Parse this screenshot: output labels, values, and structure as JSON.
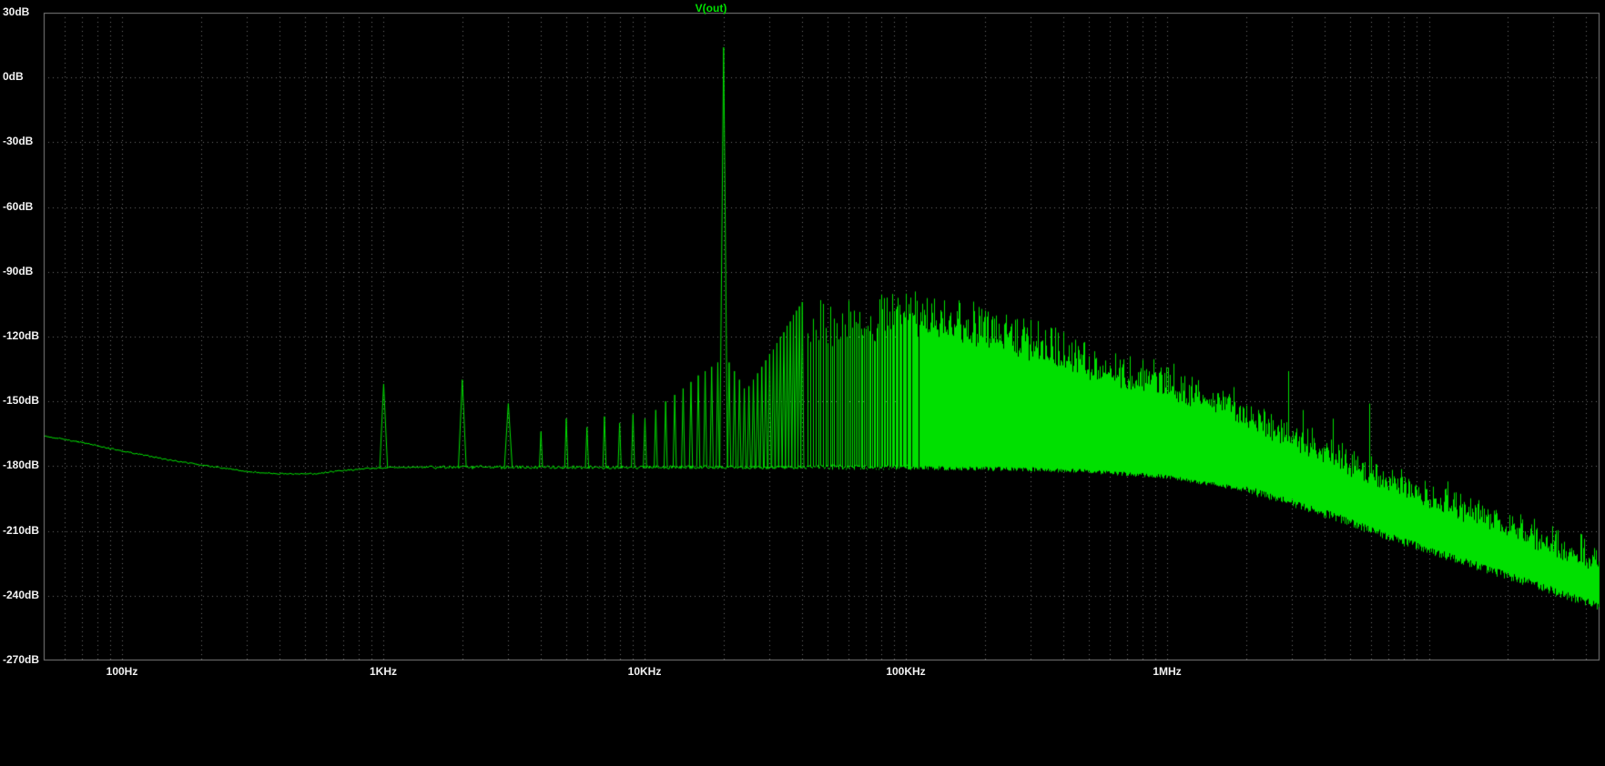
{
  "colors": {
    "background": "#000000",
    "frame": "#909090",
    "plot_border": "#808080",
    "grid": "#6E6E6E",
    "axis_label": "#F2F2F2",
    "trace": "#00E000"
  },
  "chart_data": {
    "type": "line",
    "title": "V(out)",
    "subtitle": "",
    "legend_position": "top-center",
    "grid": "dotted",
    "series": [
      {
        "name": "V(out)",
        "color": "#00E000"
      }
    ],
    "x_axis": {
      "unit": "Hz",
      "scale": "log",
      "min_hz": 50,
      "max_hz": 45000000,
      "tick_values": [
        100,
        1000,
        10000,
        100000,
        1000000
      ],
      "tick_labels": [
        "100Hz",
        "1KHz",
        "10KHz",
        "100KHz",
        "1MHz"
      ]
    },
    "y_axis": {
      "unit": "dB",
      "scale": "linear",
      "min": -270,
      "max": 30,
      "tick_step": 30,
      "tick_labels": [
        "30dB",
        "0dB",
        "-30dB",
        "-60dB",
        "-90dB",
        "-120dB",
        "-150dB",
        "-180dB",
        "-210dB",
        "-240dB",
        "-270dB"
      ]
    },
    "spectrum": {
      "point_format": "[frequency_hz, dB]",
      "floor": [
        [
          50,
          -166
        ],
        [
          70,
          -169
        ],
        [
          100,
          -173
        ],
        [
          150,
          -177
        ],
        [
          200,
          -179.5
        ],
        [
          250,
          -181
        ],
        [
          300,
          -182.5
        ],
        [
          400,
          -183.5
        ],
        [
          550,
          -183.5
        ],
        [
          700,
          -182
        ],
        [
          900,
          -181
        ],
        [
          1100,
          -180.5
        ],
        [
          20000,
          -180.5
        ],
        [
          100000,
          -180.8
        ],
        [
          300000,
          -181.5
        ],
        [
          500000,
          -182.5
        ],
        [
          1000000,
          -185
        ],
        [
          2000000,
          -191
        ],
        [
          3000000,
          -197
        ],
        [
          5000000,
          -206
        ],
        [
          7000000,
          -213
        ],
        [
          10000000,
          -219
        ],
        [
          15000000,
          -226
        ],
        [
          20000000,
          -231
        ],
        [
          30000000,
          -238
        ],
        [
          45000000,
          -245
        ]
      ],
      "peaks": [
        [
          1000,
          -142
        ],
        [
          2000,
          -140
        ],
        [
          3000,
          -151
        ],
        [
          4000,
          -164
        ],
        [
          5000,
          -158
        ],
        [
          6000,
          -162
        ],
        [
          7000,
          -157
        ],
        [
          8000,
          -160
        ],
        [
          9000,
          -156
        ],
        [
          10000,
          -158
        ],
        [
          11000,
          -154
        ],
        [
          12000,
          -150
        ],
        [
          13000,
          -147
        ],
        [
          14000,
          -144
        ],
        [
          15000,
          -141
        ],
        [
          16000,
          -138
        ],
        [
          17000,
          -136
        ],
        [
          18000,
          -134
        ],
        [
          19000,
          -132
        ],
        [
          20000,
          14
        ],
        [
          21000,
          -132
        ],
        [
          22000,
          -136
        ],
        [
          23000,
          -140
        ],
        [
          24000,
          -144
        ],
        [
          25000,
          -143
        ],
        [
          26000,
          -140
        ],
        [
          27000,
          -137
        ],
        [
          28000,
          -134
        ],
        [
          29000,
          -131
        ],
        [
          30000,
          -128
        ],
        [
          31000,
          -126
        ],
        [
          32000,
          -123
        ],
        [
          33000,
          -120
        ],
        [
          34000,
          -118
        ],
        [
          35000,
          -115
        ],
        [
          36000,
          -113
        ],
        [
          37000,
          -110
        ],
        [
          38000,
          -108
        ],
        [
          39000,
          -106
        ],
        [
          40000,
          -104
        ]
      ],
      "band": {
        "start_hz": 41000,
        "spacing_hz": 1000,
        "harmonic_spacing_hz": 20000,
        "harmonics_visible_up_to_hz": 400000,
        "mass_top": [
          [
            41000,
            -126
          ],
          [
            50000,
            -124
          ],
          [
            70000,
            -120
          ],
          [
            100000,
            -117
          ],
          [
            150000,
            -119
          ],
          [
            200000,
            -123
          ],
          [
            300000,
            -129
          ],
          [
            400000,
            -134
          ],
          [
            500000,
            -137
          ],
          [
            700000,
            -142
          ],
          [
            1000000,
            -147
          ],
          [
            1500000,
            -154
          ],
          [
            2000000,
            -160
          ],
          [
            3000000,
            -170
          ],
          [
            5000000,
            -182
          ],
          [
            7000000,
            -190
          ],
          [
            10000000,
            -197
          ],
          [
            15000000,
            -205
          ],
          [
            20000000,
            -211
          ],
          [
            30000000,
            -220
          ],
          [
            45000000,
            -228
          ]
        ],
        "peak_top": [
          [
            41000,
            -104
          ],
          [
            50000,
            -105
          ],
          [
            70000,
            -103
          ],
          [
            100000,
            -101
          ],
          [
            150000,
            -103
          ],
          [
            200000,
            -107
          ],
          [
            300000,
            -113
          ],
          [
            400000,
            -118
          ],
          [
            500000,
            -122
          ],
          [
            700000,
            -128
          ],
          [
            1000000,
            -134
          ],
          [
            1500000,
            -142
          ],
          [
            2000000,
            -149
          ],
          [
            3000000,
            -159
          ],
          [
            5000000,
            -172
          ],
          [
            7000000,
            -181
          ],
          [
            10000000,
            -186
          ],
          [
            15000000,
            -194
          ],
          [
            20000000,
            -200
          ],
          [
            30000000,
            -209
          ],
          [
            45000000,
            -217
          ]
        ]
      },
      "extra_peaks": [
        [
          1600000,
          -150
        ],
        [
          1900000,
          -152
        ],
        [
          2900000,
          -136
        ],
        [
          3300000,
          -154
        ],
        [
          4300000,
          -158
        ],
        [
          5900000,
          -151
        ]
      ]
    }
  }
}
